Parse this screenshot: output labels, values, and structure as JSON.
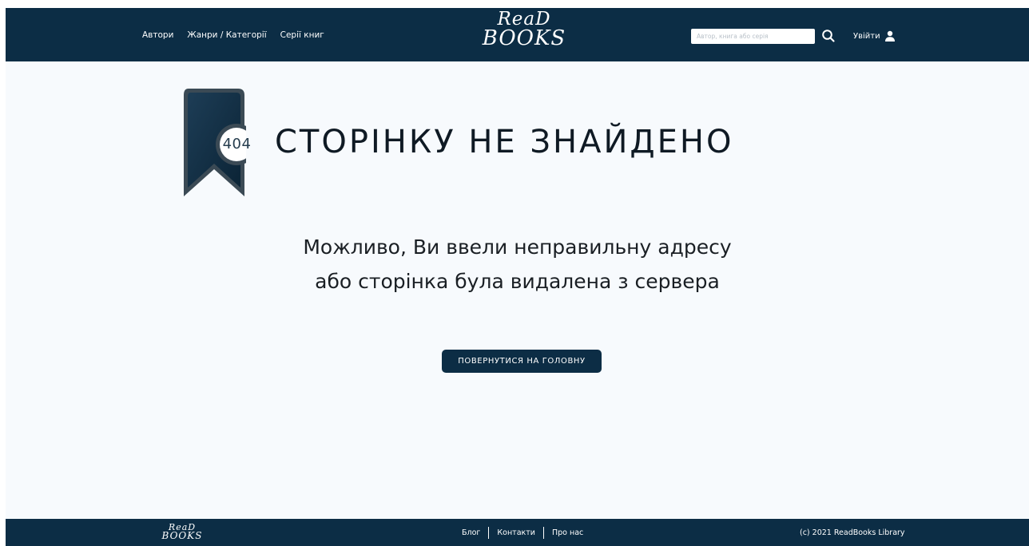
{
  "header": {
    "nav": [
      "Автори",
      "Жанри / Категорії",
      "Серії книг"
    ],
    "logo": {
      "line1": "ReaD",
      "line2": "BOOKS"
    },
    "search": {
      "placeholder": "Автор, книга або серія"
    },
    "login_label": "Увійти"
  },
  "main": {
    "code": "404",
    "title": "СТОРІНКУ НЕ ЗНАЙДЕНО",
    "message_line1": "Можливо, Ви ввели неправильну адресу",
    "message_line2": "або сторінка була видалена з сервера",
    "button_label": "ПОВЕРНУТИСЯ НА ГОЛОВНУ"
  },
  "footer": {
    "logo": {
      "line1": "ReaD",
      "line2": "BOOKS"
    },
    "links": [
      "Блог",
      "Контакти",
      "Про нас"
    ],
    "copyright": "(c) 2021 ReadBooks Library"
  },
  "colors": {
    "primary": "#0c2d45",
    "background": "#f7fafd",
    "text": "#0f1a24"
  },
  "icons": [
    "search-icon",
    "user-icon",
    "bookmark-icon"
  ]
}
